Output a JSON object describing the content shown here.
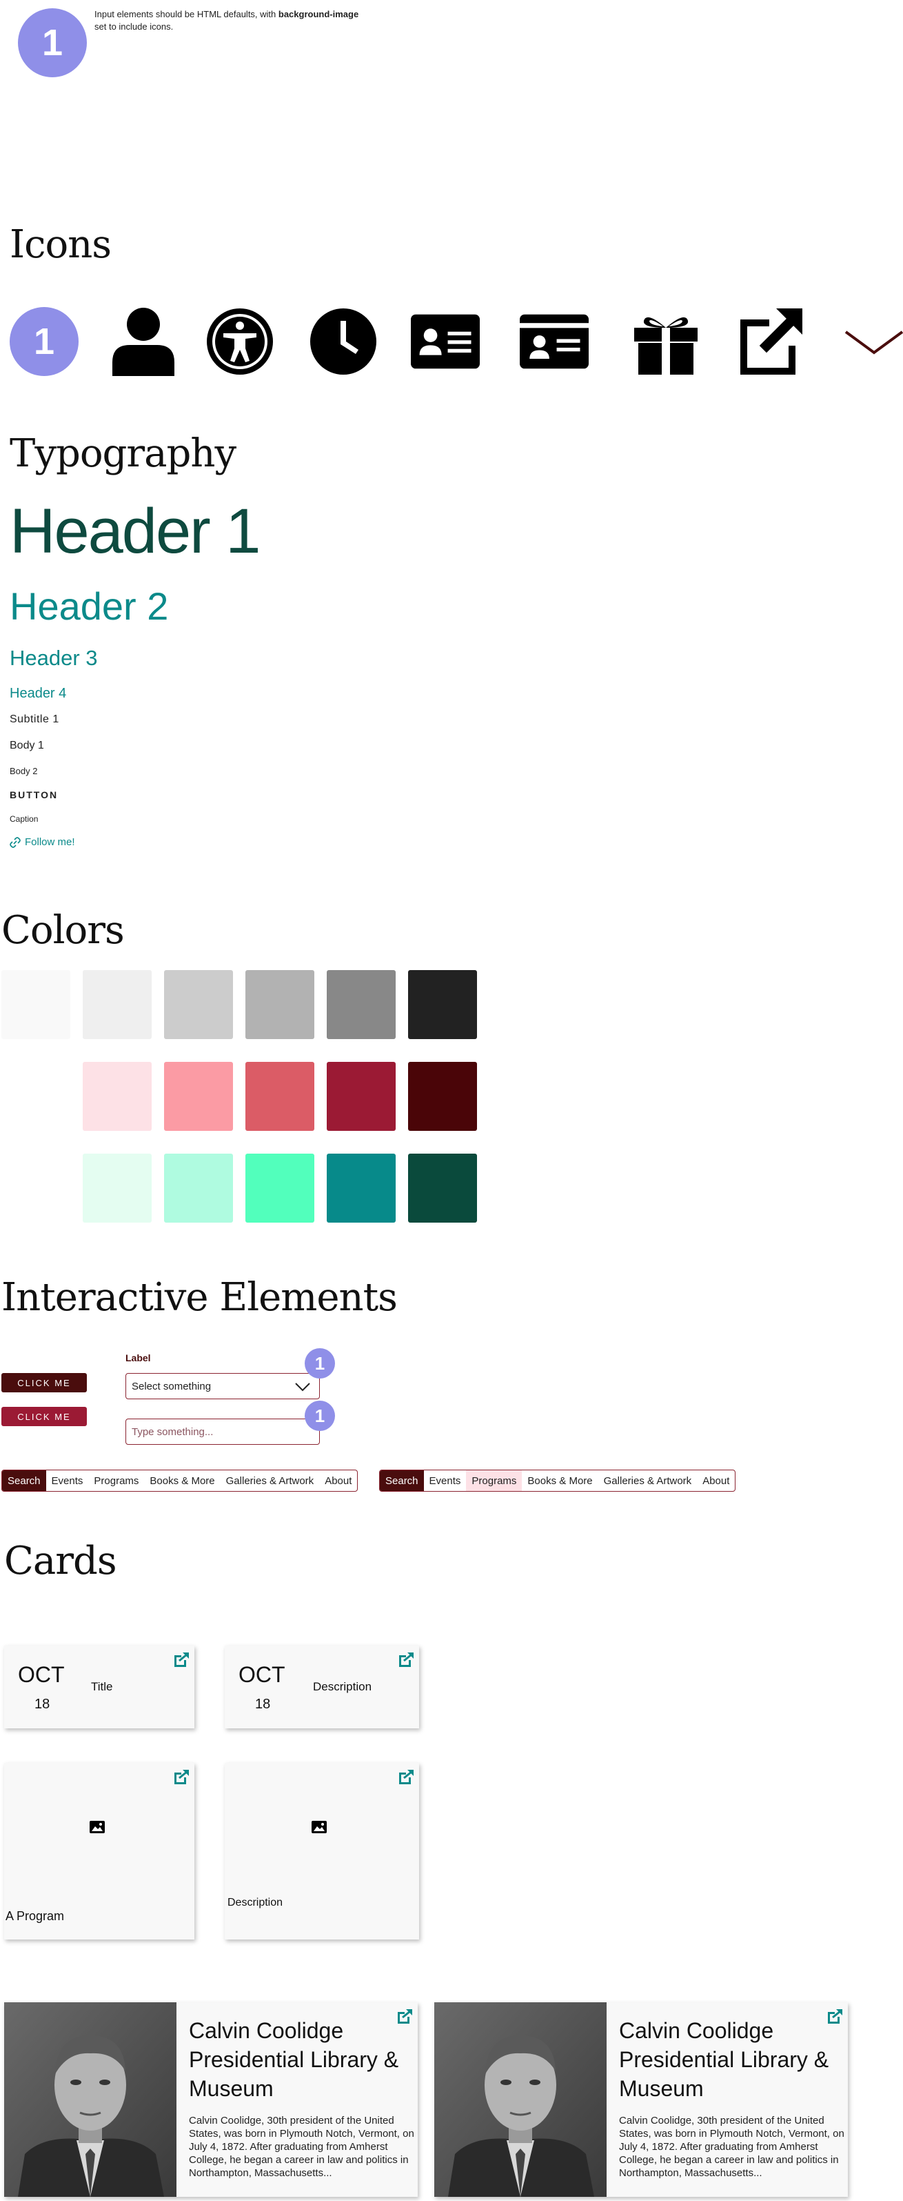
{
  "intro": {
    "badge": "1",
    "note_prefix": "Input elements should be HTML defaults, with ",
    "note_bold": "background-image",
    "note_suffix": "set to include icons."
  },
  "sections": {
    "icons": "Icons",
    "typography": "Typography",
    "colors": "Colors",
    "interactive": "Interactive Elements",
    "cards": "Cards"
  },
  "icons": {
    "badge": "1",
    "list": [
      "number-badge-icon",
      "person-icon",
      "accessibility-icon",
      "clock-icon",
      "id-card-icon",
      "library-card-icon",
      "gift-icon",
      "external-link-icon",
      "chevron-down-icon"
    ]
  },
  "typography": {
    "h1": "Header 1",
    "h2": "Header 2",
    "h3": "Header 3",
    "h4": "Header 4",
    "subtitle1": "Subtitle 1",
    "body1": "Body 1",
    "body2": "Body 2",
    "button": "BUTTON",
    "caption": "Caption",
    "link": "Follow me!"
  },
  "colors": {
    "grays": [
      "#f9f9f9",
      "#efefef",
      "#cccccc",
      "#b2b2b2",
      "#888888",
      "#222222"
    ],
    "reds": [
      "#fde1e6",
      "#fb9ba4",
      "#db5c66",
      "#9b1a34",
      "#4a0508"
    ],
    "greens": [
      "#e4fdf1",
      "#affbe0",
      "#52ffbc",
      "#078a8a",
      "#0a4a3c"
    ]
  },
  "interactive": {
    "button_primary": "CLICK ME",
    "button_secondary": "CLICK ME",
    "label": "Label",
    "select_value": "Select something",
    "input_placeholder": "Type something...",
    "badge": "1",
    "nav_items": [
      "Search",
      "Events",
      "Programs",
      "Books & More",
      "Galleries & Artwork",
      "About"
    ]
  },
  "cards": {
    "event1": {
      "month": "OCT",
      "day": "18",
      "text": "Title"
    },
    "event2": {
      "month": "OCT",
      "day": "18",
      "text": "Description"
    },
    "program1": {
      "text": "A Program"
    },
    "program2": {
      "text": "Description"
    },
    "bio": {
      "title": "Calvin Coolidge Presidential Library & Museum",
      "text": "Calvin Coolidge, 30th president of the United States, was born in Plymouth Notch, Vermont, on July 4, 1872. After graduating from Amherst College, he began a career in law and politics in Northampton, Massachusetts..."
    }
  }
}
